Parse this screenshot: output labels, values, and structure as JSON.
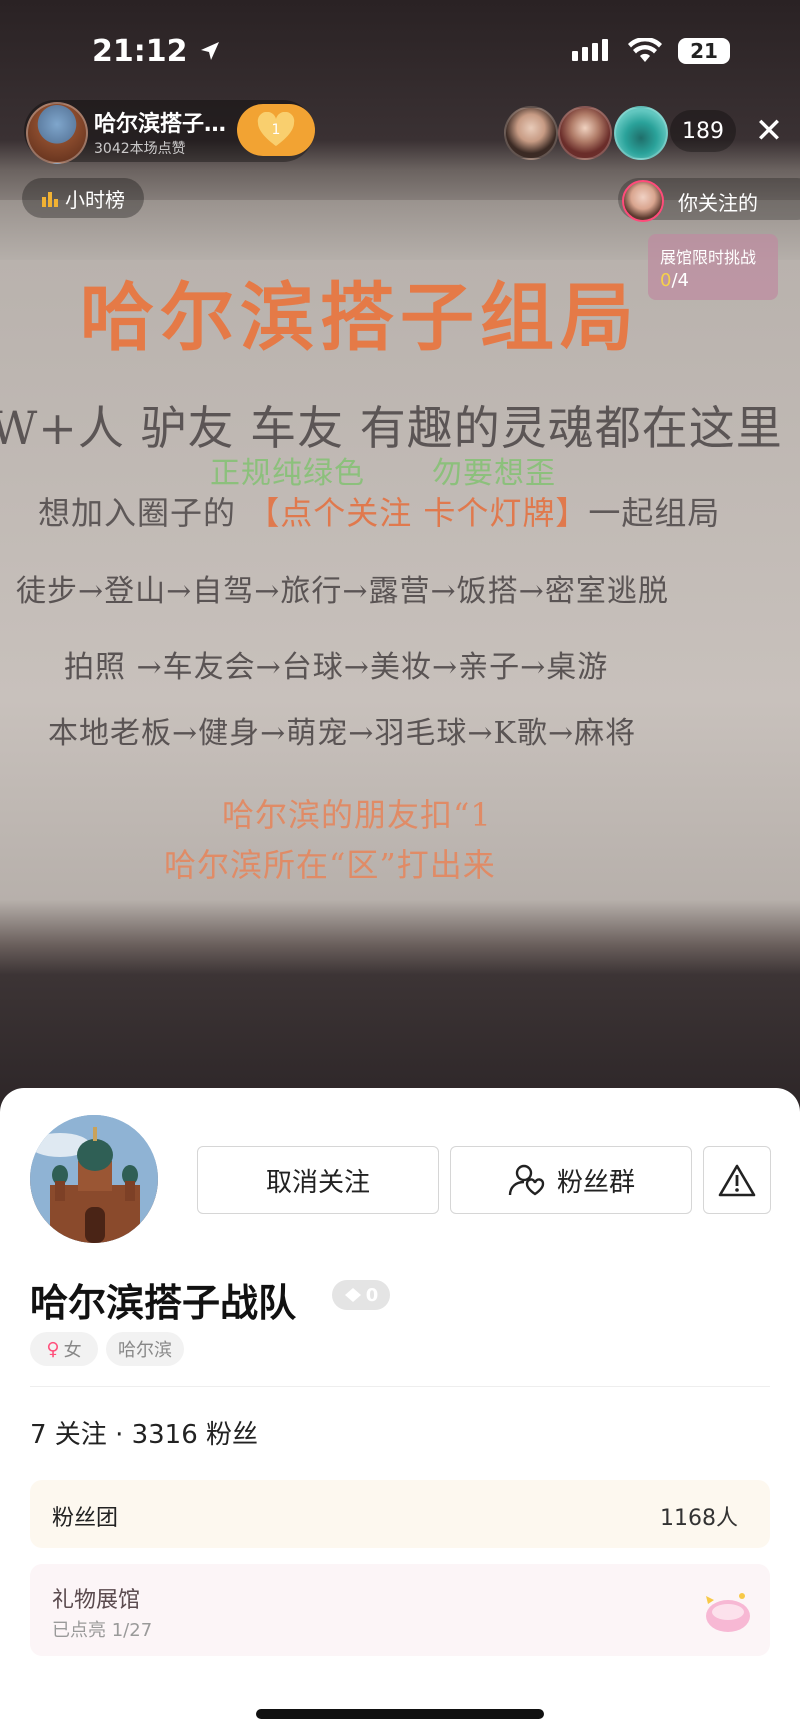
{
  "status_bar": {
    "time": "21:12",
    "battery": "21"
  },
  "host": {
    "name": "哈尔滨搭子…",
    "likes": "3042本场点赞",
    "fan_level": "1"
  },
  "viewers": {
    "count": "189"
  },
  "hourly_rank": {
    "label": "小时榜"
  },
  "follow_pill": {
    "label": "你关注的"
  },
  "challenge": {
    "title": "展馆限时挑战",
    "progress_done": "0",
    "progress_total": "/4"
  },
  "slide": {
    "title": "哈尔滨搭子组局",
    "subtitle": "W+人  驴友  车友  有趣的灵魂都在这里",
    "green1": "正规纯绿色",
    "green2": "勿要想歪",
    "join_prefix": "想加入圈子的 ",
    "join_highlight": "【点个关注  卡个灯牌】",
    "join_suffix": "一起组局",
    "line3": "徒步→登山→自驾→旅行→露营→饭搭→密室逃脱",
    "line4": "拍照  →车友会→台球→美妆→亲子→桌游",
    "line5": "本地老板→健身→萌宠→羽毛球→K歌→麻将",
    "line6": "哈尔滨的朋友扣“1",
    "line7": "哈尔滨所在“区”打出来"
  },
  "profile": {
    "unfollow_label": "取消关注",
    "fan_group_label": "粉丝群",
    "name": "哈尔滨搭子战队",
    "level": "0",
    "gender": "女",
    "location": "哈尔滨",
    "stats": "7 关注 · 3316 粉丝",
    "fan_club_label": "粉丝团",
    "fan_club_count": "1168人",
    "gift_hall_label": "礼物展馆",
    "gift_hall_progress": "已点亮 1/27"
  }
}
